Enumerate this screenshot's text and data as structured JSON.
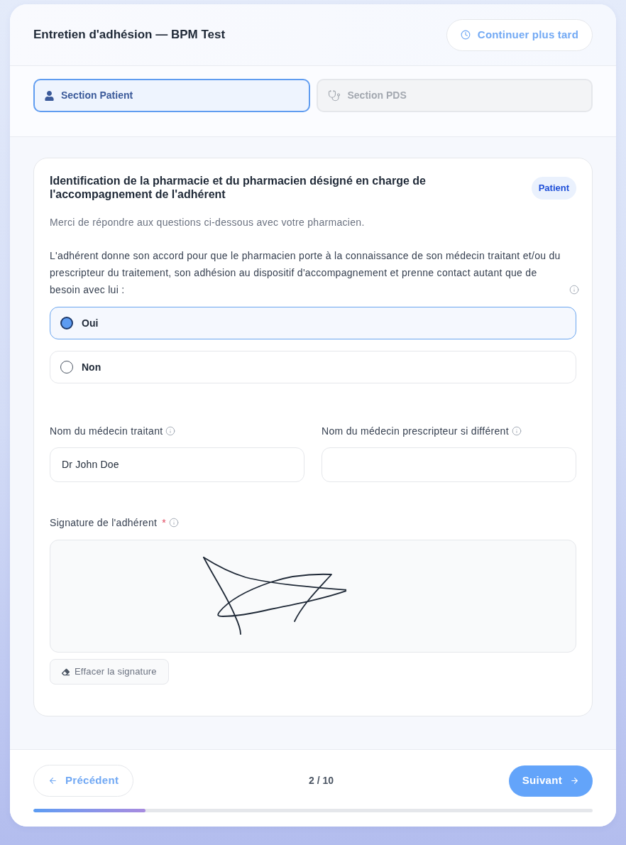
{
  "header": {
    "title": "Entretien d'adhésion — BPM Test",
    "later_button": "Continuer plus tard"
  },
  "tabs": [
    {
      "label": "Section Patient",
      "selected": true,
      "kind": "person"
    },
    {
      "label": "Section PDS",
      "selected": false,
      "kind": "stethoscope"
    }
  ],
  "card": {
    "title": "Identification de la pharmacie et du pharmacien désigné en charge de l'accompagnement de l'adhérent",
    "badge": "Patient",
    "subtitle": "Merci de répondre aux questions ci-dessous avec votre pharmacien.",
    "question": {
      "text": "L'adhérent donne son accord pour que le pharmacien porte à la connaissance de son médecin traitant et/ou du prescripteur du traitement, son adhésion au dispositif d'accompagnement et prenne contact autant que de besoin avec lui :",
      "info": true
    },
    "options": [
      {
        "label": "Oui",
        "selected": true
      },
      {
        "label": "Non",
        "selected": false
      }
    ],
    "fields": [
      {
        "label": "Nom du médecin traitant",
        "info": true,
        "value": "Dr John Doe"
      },
      {
        "label": "Nom du médecin prescripteur si différent",
        "info": true
      }
    ],
    "signature": {
      "label": "Signature de l'adhérent",
      "required_mark": "*",
      "info": true,
      "signed": true,
      "clear_button": "Effacer la signature"
    }
  },
  "footer": {
    "prev_button": "Précédent",
    "page": "2 / 10",
    "next_button": "Suivant",
    "progress": {
      "level": 0.2
    }
  }
}
